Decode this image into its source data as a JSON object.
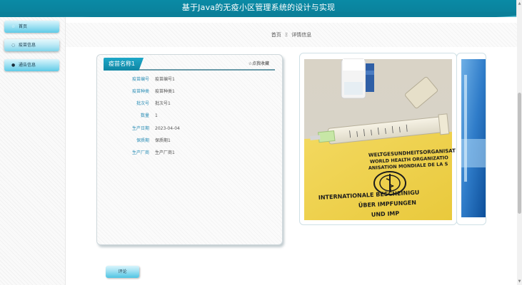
{
  "header": {
    "title": "基于Java的无疫小区管理系统的设计与实现"
  },
  "sidebar": {
    "items": [
      {
        "label": "首页",
        "icon": "home-icon",
        "glyph": "☆"
      },
      {
        "label": "疫苗信息",
        "icon": "vaccine-icon",
        "glyph": "◌"
      },
      {
        "label": "通告信息",
        "icon": "notice-icon",
        "glyph": "●"
      }
    ]
  },
  "breadcrumb": {
    "home": "首页",
    "separator": "Ξ",
    "current": "详情信息"
  },
  "detail": {
    "title": "疫苗名称1",
    "favorite_label": "☆点我收藏",
    "fields": [
      {
        "label": "疫苗编号",
        "value": "疫苗编号1"
      },
      {
        "label": "疫苗种类",
        "value": "疫苗种类1"
      },
      {
        "label": "批次号",
        "value": "批次号1"
      },
      {
        "label": "数量",
        "value": "1"
      },
      {
        "label": "生产日期",
        "value": "2023-04-04"
      },
      {
        "label": "保质期",
        "value": "保质期1"
      },
      {
        "label": "生产厂商",
        "value": "生产厂商1"
      }
    ]
  },
  "gallery": {
    "cert_lines": [
      "WELTGESUNDHEITSORGANISAT",
      "WORLD HEALTH ORGANIZATIO",
      "ANISATION MONDIALE DE LA S",
      "INTERNATIONALE BESCHEINIGU",
      "ÜBER IMPFUNGEN",
      "UND IMP"
    ]
  },
  "actions": {
    "comment_label": "评论"
  },
  "colors": {
    "header": "#0b87a3",
    "accent": "#2a8db5",
    "button": "#7fd4ea"
  }
}
